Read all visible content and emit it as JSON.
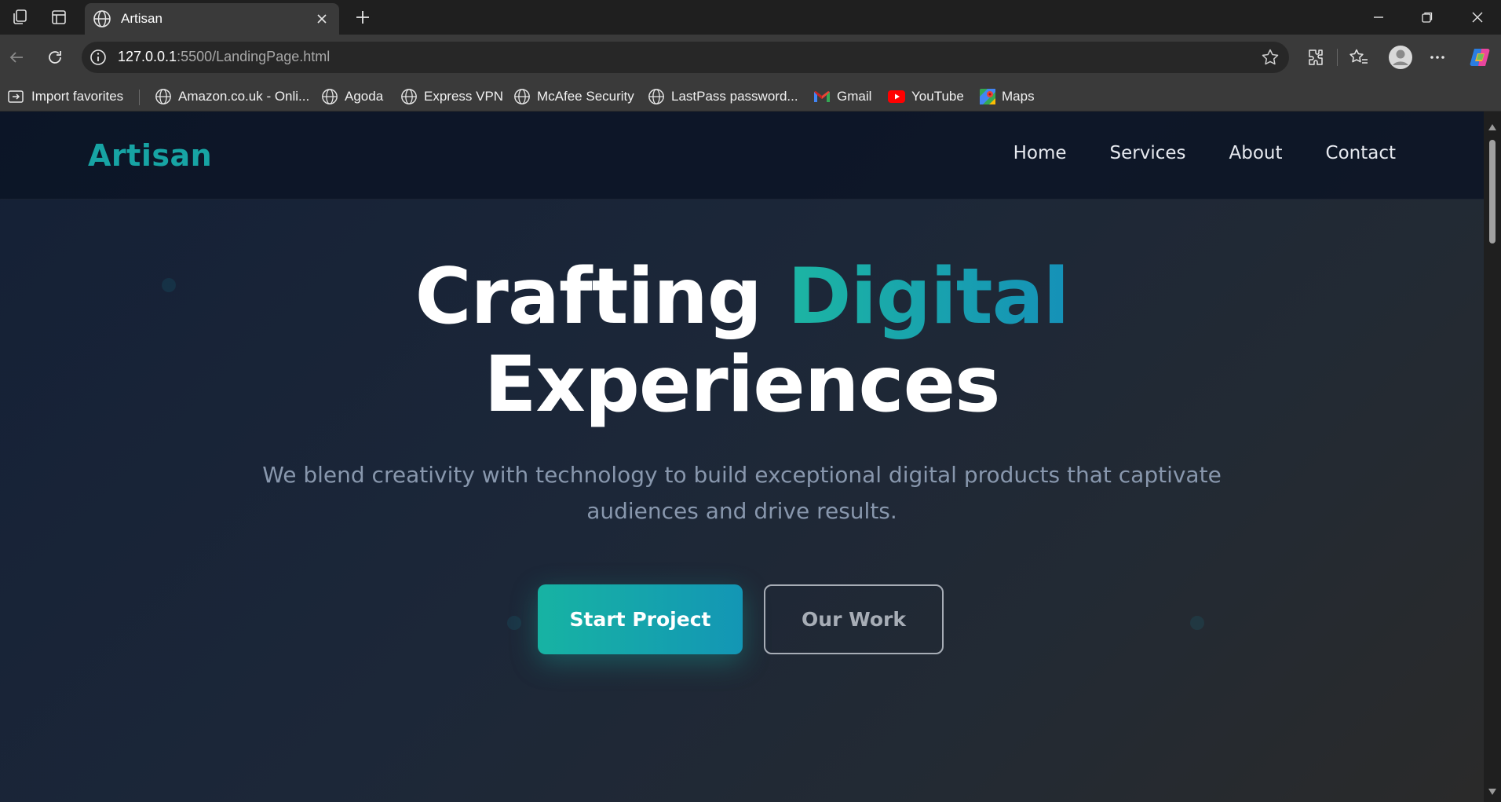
{
  "browser": {
    "tab_title": "Artisan",
    "url_host": "127.0.0.1",
    "url_path": ":5500/LandingPage.html",
    "bookmarks": [
      {
        "label": "Import favorites",
        "icon": "import-icon"
      },
      {
        "label": "Amazon.co.uk - Onli...",
        "icon": "globe-icon"
      },
      {
        "label": "Agoda",
        "icon": "globe-icon"
      },
      {
        "label": "Express VPN",
        "icon": "globe-icon"
      },
      {
        "label": "McAfee Security",
        "icon": "globe-icon"
      },
      {
        "label": "LastPass password...",
        "icon": "globe-icon"
      },
      {
        "label": "Gmail",
        "icon": "gmail-icon"
      },
      {
        "label": "YouTube",
        "icon": "youtube-icon"
      },
      {
        "label": "Maps",
        "icon": "maps-icon"
      }
    ]
  },
  "site": {
    "brand": "Artisan",
    "nav": [
      "Home",
      "Services",
      "About",
      "Contact"
    ],
    "hero": {
      "title_part1": "Crafting ",
      "title_accent": "Digital",
      "title_line2": "Experiences",
      "subtitle": "We blend creativity with technology to build exceptional digital products that captivate audiences and drive results.",
      "primary_cta": "Start Project",
      "secondary_cta": "Our Work"
    },
    "colors": {
      "accent": "#17a4a4",
      "gradient_start": "#17b3a3",
      "gradient_end": "#1396b5",
      "nav_bg": "#0b1324"
    }
  }
}
